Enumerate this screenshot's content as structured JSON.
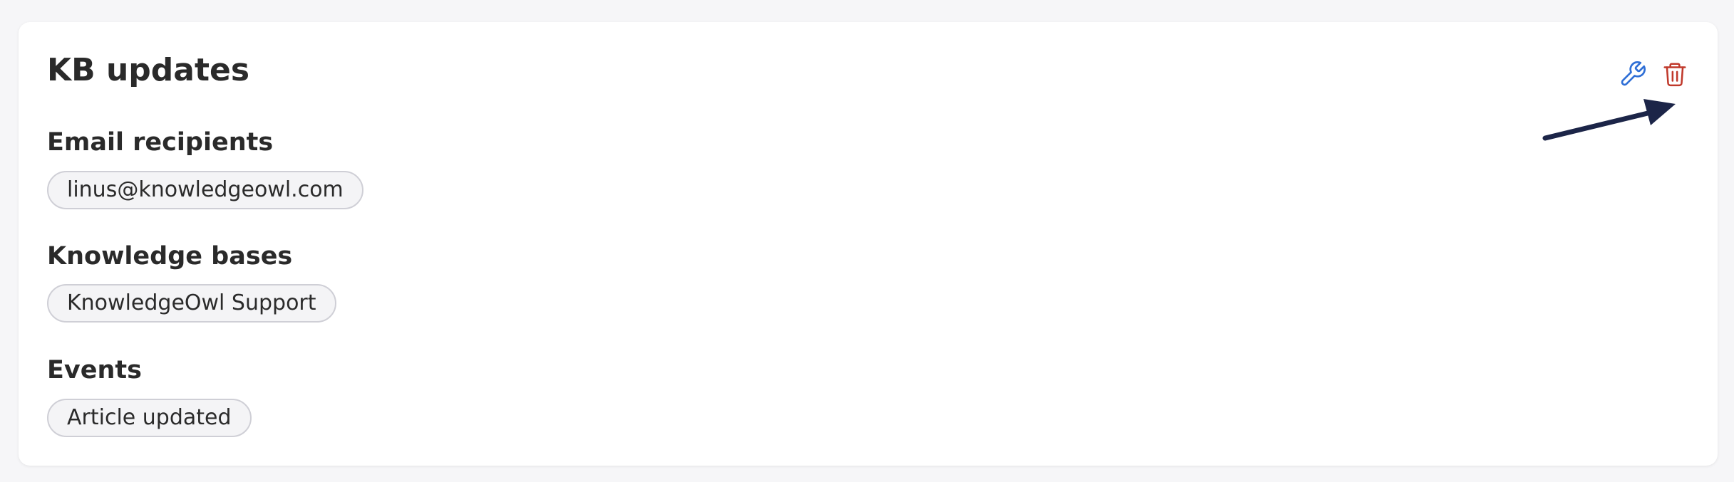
{
  "card": {
    "title": "KB updates"
  },
  "sections": {
    "email": {
      "heading": "Email recipients",
      "chip": "linus@knowledgeowl.com"
    },
    "kbs": {
      "heading": "Knowledge bases",
      "chip": "KnowledgeOwl Support"
    },
    "events": {
      "heading": "Events",
      "chip": "Article updated"
    }
  },
  "actions": {
    "edit_icon": "wrench-icon",
    "delete_icon": "trash-icon"
  },
  "colors": {
    "edit": "#2f6fd6",
    "delete": "#c0392b",
    "arrow": "#1c2548"
  }
}
